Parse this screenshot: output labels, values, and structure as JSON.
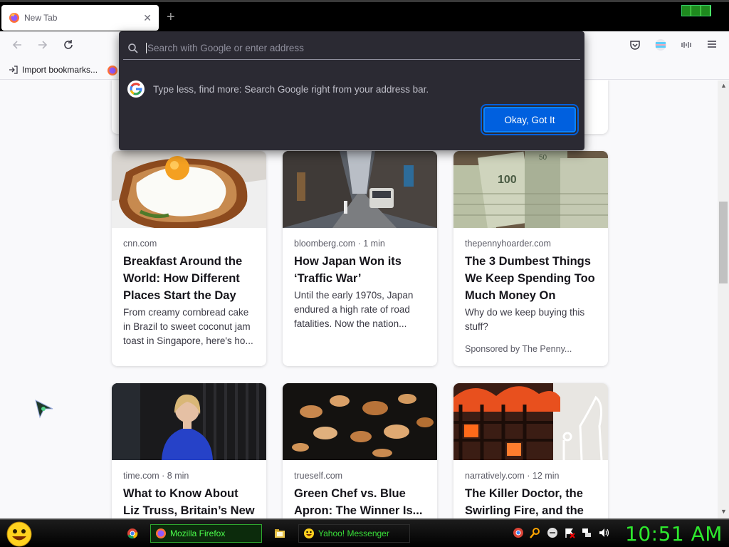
{
  "tab": {
    "title": "New Tab"
  },
  "bookmarks": {
    "import_label": "Import bookmarks..."
  },
  "popup": {
    "placeholder": "Search with Google or enter address",
    "tip": "Type less, find more: Search Google right from your address bar.",
    "ok_label": "Okay, Got It"
  },
  "top_card_fragment": "...",
  "cards": [
    {
      "source": "cnn.com",
      "headline": "Breakfast Around the World: How Different Places Start the Day",
      "excerpt": "From creamy cornbread cake in Brazil to sweet coconut jam toast in Singapore, here's ho..."
    },
    {
      "source": "bloomberg.com · 1 min",
      "headline": "How Japan Won its ‘Traffic War’",
      "excerpt": "Until the early 1970s, Japan endured a high rate of road fatalities. Now the nation..."
    },
    {
      "source": "thepennyhoarder.com",
      "headline": "The 3 Dumbest Things We Keep Spending Too Much Money On",
      "excerpt": "Why do we keep buying this stuff?",
      "sponsor": "Sponsored by The Penny..."
    },
    {
      "source": "time.com · 8 min",
      "headline": "What to Know About Liz Truss, Britain’s New"
    },
    {
      "source": "trueself.com",
      "headline": "Green Chef vs. Blue Apron: The Winner Is..."
    },
    {
      "source": "narratively.com · 12 min",
      "headline": "The Killer Doctor, the Swirling Fire, and the"
    }
  ],
  "taskbar": {
    "firefox_label": "Mozilla Firefox",
    "messenger_label": "Yahoo! Messenger",
    "clock": "10:51 AM"
  },
  "colors": {
    "accent": "#0060df",
    "popup_bg": "#2b2a33",
    "taskbar_text": "#2ee82e"
  }
}
